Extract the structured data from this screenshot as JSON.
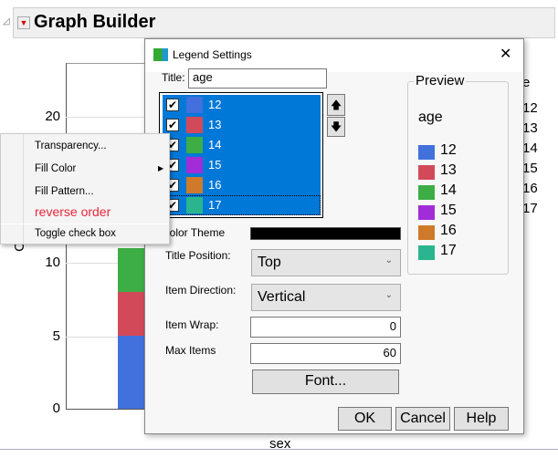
{
  "graph": {
    "title": "Graph Builder",
    "y_label": "C",
    "x_label": "sex",
    "y_ticks": [
      "20",
      "10",
      "5",
      "0"
    ],
    "bars": [
      {
        "value": 5,
        "color": "#4270dd"
      },
      {
        "value": 3,
        "color": "#d24a5a"
      },
      {
        "value": 3,
        "color": "#3cae45"
      }
    ],
    "bg_legend": {
      "title": "e",
      "items": [
        "12",
        "13",
        "14",
        "15",
        "16",
        "17"
      ]
    }
  },
  "dialog": {
    "title": "Legend Settings",
    "close": "✕",
    "title_label": "Title:",
    "title_value": "age",
    "items": [
      {
        "label": "12",
        "color": "#4270dd",
        "checked": true
      },
      {
        "label": "13",
        "color": "#d24a5a",
        "checked": true
      },
      {
        "label": "14",
        "color": "#3cae45",
        "checked": true
      },
      {
        "label": "15",
        "color": "#a12dd8",
        "checked": true
      },
      {
        "label": "16",
        "color": "#cf7a2a",
        "checked": true
      },
      {
        "label": "17",
        "color": "#2ab58e",
        "checked": true
      }
    ],
    "up": "🡅",
    "down": "🡇",
    "preview": {
      "label": "Preview",
      "title": "age"
    },
    "color_theme_label": "Color Theme",
    "color_theme_value": "#000000",
    "title_position_label": "Title Position:",
    "title_position": "Top",
    "item_direction_label": "Item Direction:",
    "item_direction": "Vertical",
    "item_wrap_label": "Item Wrap:",
    "item_wrap": "0",
    "max_items_label": "Max Items",
    "max_items": "60",
    "font_button": "Font...",
    "ok": "OK",
    "cancel": "Cancel",
    "help": "Help"
  },
  "context_menu": {
    "items": [
      "Transparency...",
      "Fill Color",
      "Fill Pattern...",
      "reverse order",
      "Toggle check box"
    ]
  }
}
